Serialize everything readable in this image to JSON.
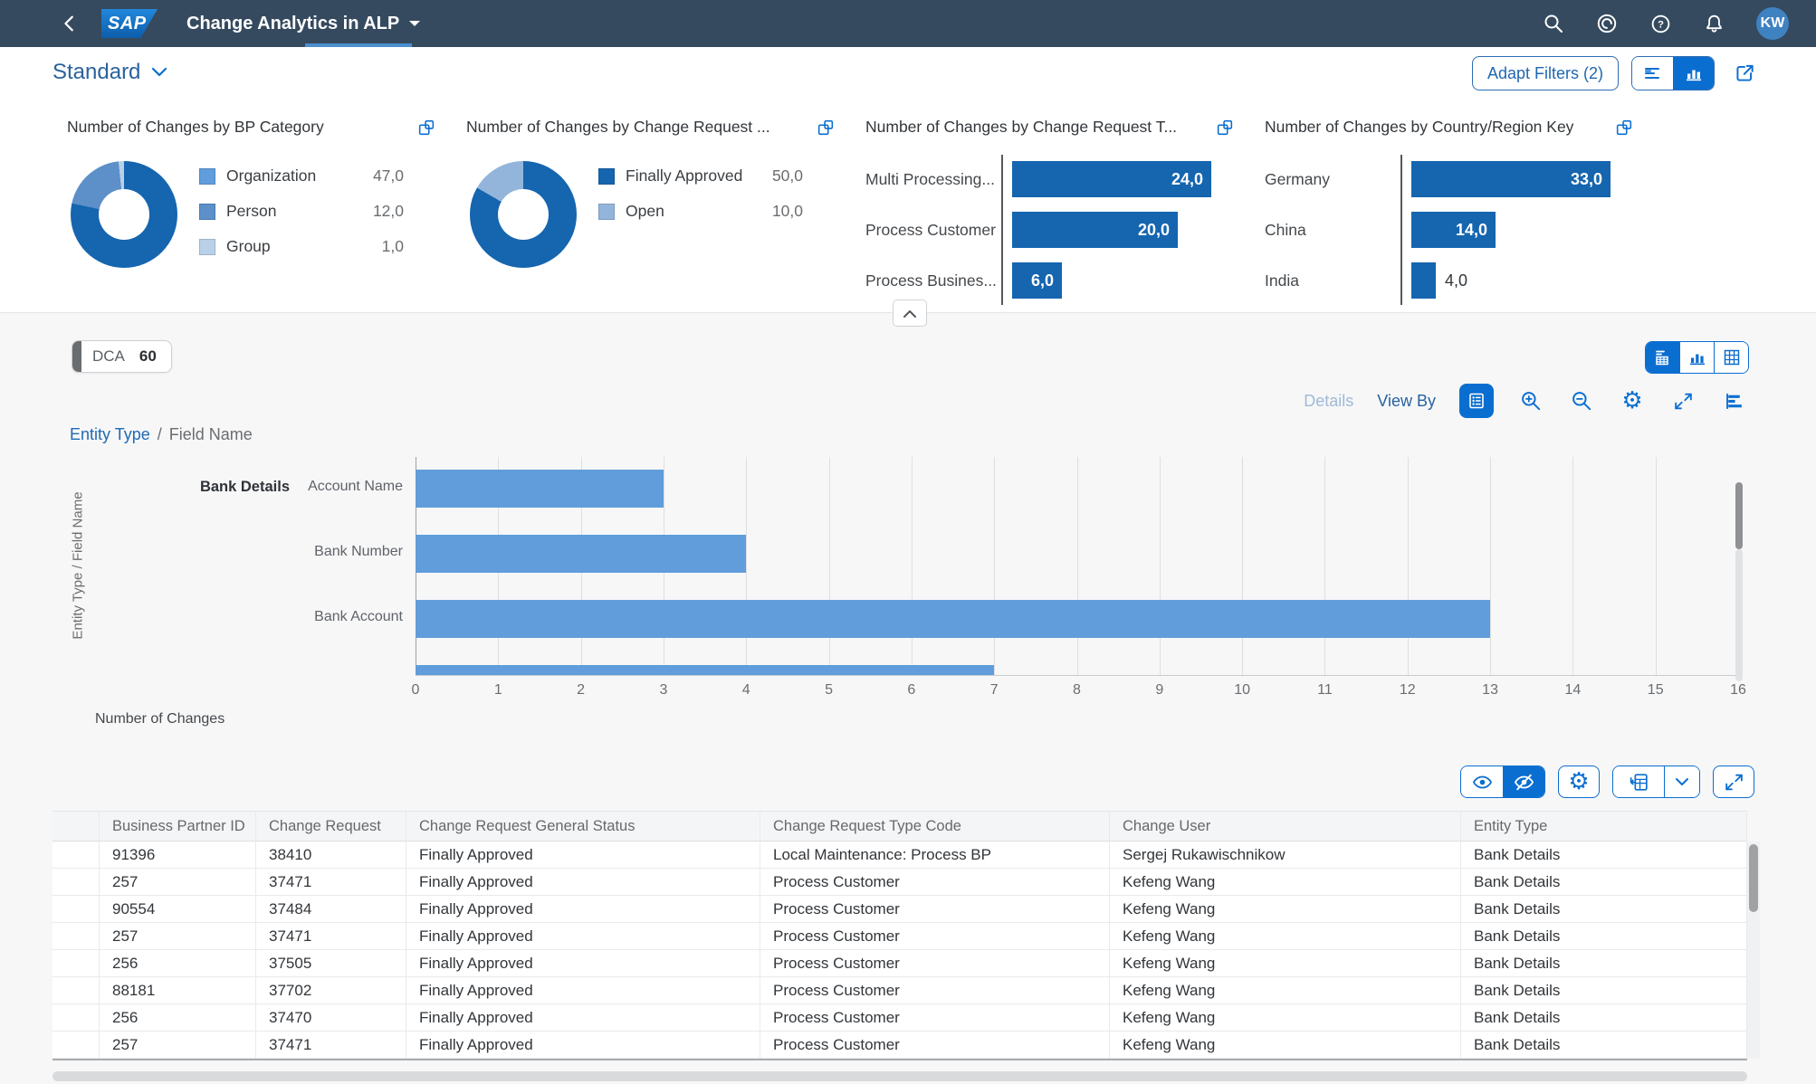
{
  "shell": {
    "logo_text": "SAP",
    "title": "Change Analytics in ALP",
    "avatar_initials": "KW"
  },
  "filter_bar": {
    "variant": "Standard",
    "adapt_filters_label": "Adapt Filters (2)"
  },
  "kpi_cards": [
    {
      "title": "Number of Changes by BP Category",
      "type": "donut",
      "items": [
        {
          "label": "Organization",
          "value": "47,0",
          "num": 47,
          "color": "#1565af"
        },
        {
          "label": "Person",
          "value": "12,0",
          "num": 12,
          "color": "#5d8fc8"
        },
        {
          "label": "Group",
          "value": "1,0",
          "num": 1,
          "color": "#bad0e8"
        }
      ]
    },
    {
      "title": "Number of Changes by Change Request ...",
      "type": "donut",
      "items": [
        {
          "label": "Finally Approved",
          "value": "50,0",
          "num": 50,
          "color": "#1565af"
        },
        {
          "label": "Open",
          "value": "10,0",
          "num": 10,
          "color": "#93b5db"
        }
      ]
    },
    {
      "title": "Number of Changes by Change Request T...",
      "type": "bar",
      "bar_color": "#1565af",
      "items": [
        {
          "label": "Multi Processing...",
          "value": "24,0",
          "num": 24
        },
        {
          "label": "Process Customer",
          "value": "20,0",
          "num": 20
        },
        {
          "label": "Process Busines...",
          "value": "6,0",
          "num": 6
        }
      ]
    },
    {
      "title": "Number of Changes by Country/Region Key",
      "type": "bar",
      "bar_color": "#1565af",
      "items": [
        {
          "label": "Germany",
          "value": "33,0",
          "num": 33
        },
        {
          "label": "China",
          "value": "14,0",
          "num": 14
        },
        {
          "label": "India",
          "value": "4,0",
          "num": 4
        }
      ]
    }
  ],
  "content_header": {
    "kpi_tag": {
      "label": "DCA",
      "value": "60"
    },
    "chart_toolbar": {
      "details": "Details",
      "view_by": "View By"
    },
    "breadcrumb": {
      "link": "Entity Type",
      "separator": "/",
      "current": "Field Name"
    }
  },
  "chart_data": {
    "type": "bar",
    "orientation": "horizontal",
    "group_label": "Bank Details",
    "categories": [
      "Account Name",
      "Bank Number",
      "Bank Account"
    ],
    "values": [
      3,
      4,
      13
    ],
    "partial_bar_value": 7,
    "xlabel": "",
    "ylabel": "Entity Type / Field Name",
    "xlim": [
      0,
      16
    ],
    "x_ticks": [
      0,
      1,
      2,
      3,
      4,
      5,
      6,
      7,
      8,
      9,
      10,
      11,
      12,
      13,
      14,
      15,
      16
    ],
    "grid": true,
    "bar_color": "#609dda",
    "legend": [
      {
        "label": "Number of Changes",
        "color": "#609dda"
      }
    ],
    "legend_position": "bottom-left"
  },
  "table": {
    "columns": [
      "Business Partner ID",
      "Change Request",
      "Change Request General Status",
      "Change Request Type Code",
      "Change User",
      "Entity Type"
    ],
    "rows": [
      [
        "91396",
        "38410",
        "Finally Approved",
        "Local Maintenance: Process BP",
        "Sergej Rukawischnikow",
        "Bank Details"
      ],
      [
        "257",
        "37471",
        "Finally Approved",
        "Process Customer",
        "Kefeng Wang",
        "Bank Details"
      ],
      [
        "90554",
        "37484",
        "Finally Approved",
        "Process Customer",
        "Kefeng Wang",
        "Bank Details"
      ],
      [
        "257",
        "37471",
        "Finally Approved",
        "Process Customer",
        "Kefeng Wang",
        "Bank Details"
      ],
      [
        "256",
        "37505",
        "Finally Approved",
        "Process Customer",
        "Kefeng Wang",
        "Bank Details"
      ],
      [
        "88181",
        "37702",
        "Finally Approved",
        "Process Customer",
        "Kefeng Wang",
        "Bank Details"
      ],
      [
        "256",
        "37470",
        "Finally Approved",
        "Process Customer",
        "Kefeng Wang",
        "Bank Details"
      ],
      [
        "257",
        "37471",
        "Finally Approved",
        "Process Customer",
        "Kefeng Wang",
        "Bank Details"
      ]
    ]
  },
  "colors": {
    "accent": "#0a6ed1",
    "shell_bg": "#354a5f",
    "kpi_dark_blue": "#1565af",
    "chart_bar_blue": "#609dda"
  }
}
